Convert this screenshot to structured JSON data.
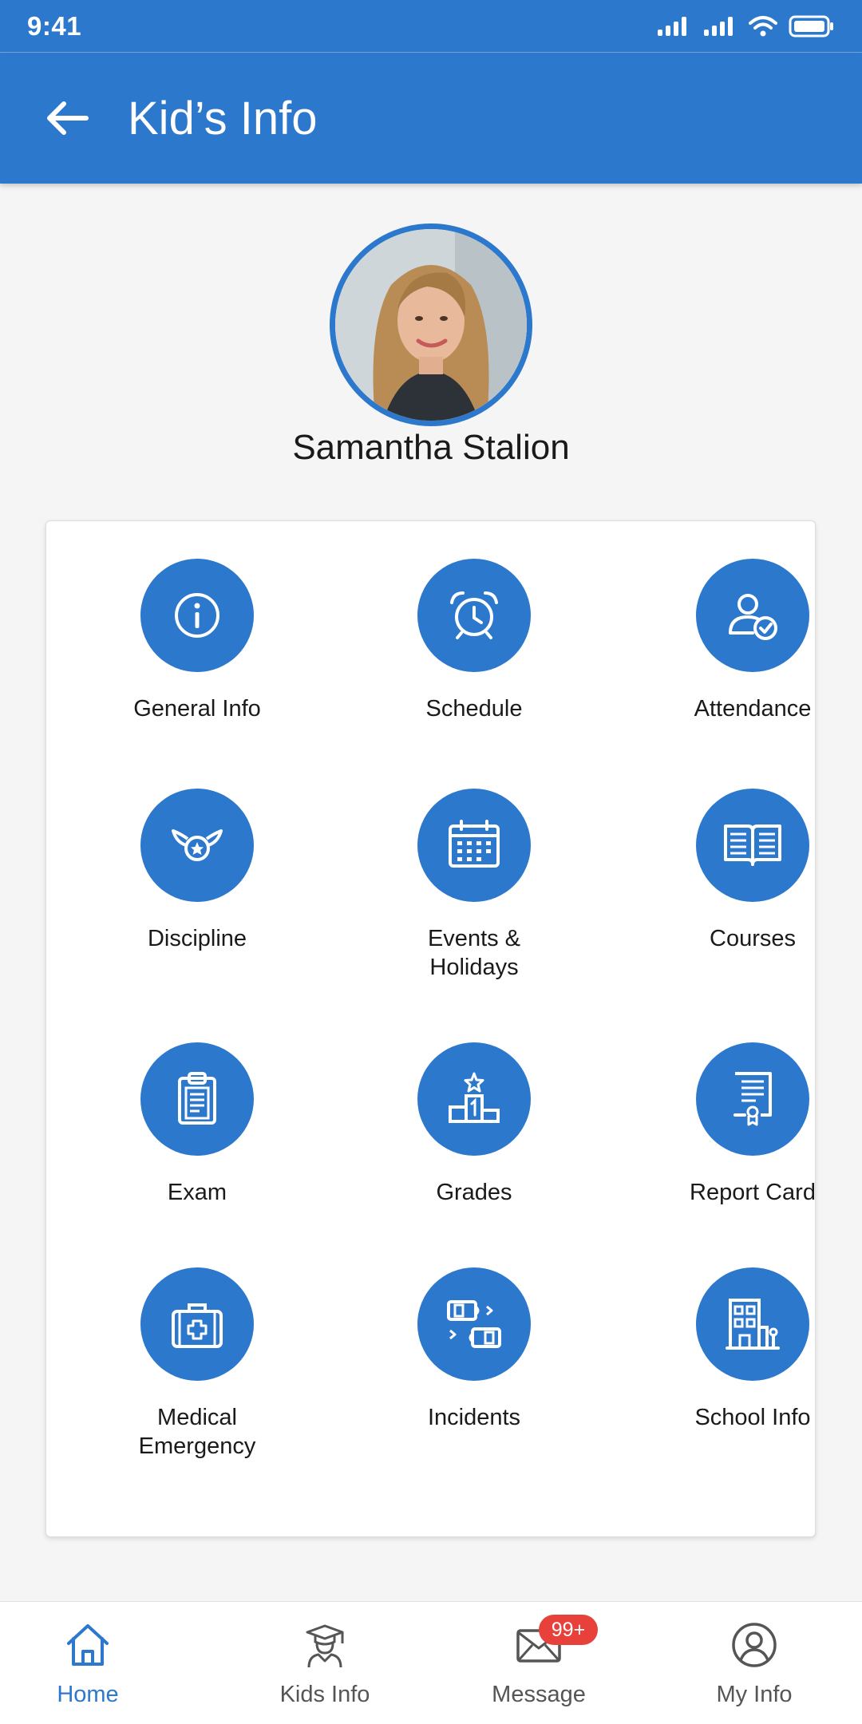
{
  "status_bar": {
    "time": "9:41"
  },
  "app_bar": {
    "title": "Kid’s Info",
    "back_icon": "arrow-left-icon"
  },
  "profile": {
    "name": "Samantha Stalion"
  },
  "menu": [
    {
      "label": "General Info",
      "icon": "info-icon"
    },
    {
      "label": "Schedule",
      "icon": "alarm-clock-icon"
    },
    {
      "label": "Attendance",
      "icon": "user-check-icon"
    },
    {
      "label": "Discipline",
      "icon": "winged-star-badge-icon"
    },
    {
      "label": "Events &\nHolidays",
      "icon": "calendar-icon"
    },
    {
      "label": "Courses",
      "icon": "open-book-icon"
    },
    {
      "label": "Exam",
      "icon": "clipboard-icon"
    },
    {
      "label": "Grades",
      "icon": "podium-icon"
    },
    {
      "label": "Report Card",
      "icon": "certificate-icon"
    },
    {
      "label": "Medical\nEmergency",
      "icon": "medical-kit-icon"
    },
    {
      "label": "Incidents",
      "icon": "incident-icon"
    },
    {
      "label": "School Info",
      "icon": "building-icon"
    }
  ],
  "bottom_nav": [
    {
      "label": "Home",
      "icon": "home-icon",
      "active": true
    },
    {
      "label": "Kids Info",
      "icon": "graduate-icon",
      "active": false
    },
    {
      "label": "Message",
      "icon": "envelope-icon",
      "active": false,
      "badge": "99+"
    },
    {
      "label": "My Info",
      "icon": "user-circle-icon",
      "active": false
    }
  ],
  "colors": {
    "primary": "#2c78cc",
    "badge": "#e8403a",
    "background": "#f5f5f5"
  }
}
